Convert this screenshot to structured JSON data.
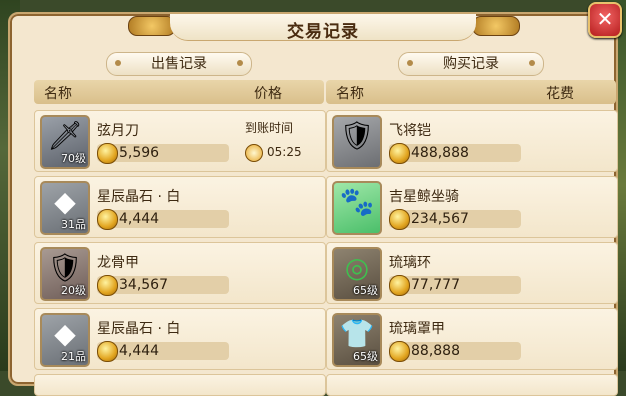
{
  "title": "交易记录",
  "close_label": "✕",
  "sell": {
    "tab_label": "出售记录",
    "col_name": "名称",
    "col_price": "价格",
    "arrival_label": "到账时间",
    "rows": [
      {
        "name": "弦月刀",
        "price": "5,596",
        "level": "70级",
        "icon": "blade-icon",
        "time": "05:25"
      },
      {
        "name": "星辰晶石 · 白",
        "price": "4,444",
        "level": "31品",
        "icon": "crystal-icon"
      },
      {
        "name": "龙骨甲",
        "price": "34,567",
        "level": "20级",
        "icon": "armor-icon"
      },
      {
        "name": "星辰晶石 · 白",
        "price": "4,444",
        "level": "21品",
        "icon": "crystal-icon"
      }
    ]
  },
  "buy": {
    "tab_label": "购买记录",
    "col_name": "名称",
    "col_price": "花费",
    "rows": [
      {
        "name": "飞将铠",
        "price": "488,888",
        "level": "",
        "icon": "armor-icon"
      },
      {
        "name": "吉星鲸坐骑",
        "price": "234,567",
        "level": "",
        "icon": "mount-icon"
      },
      {
        "name": "琉璃环",
        "price": "77,777",
        "level": "65级",
        "icon": "ring-icon"
      },
      {
        "name": "琉璃罩甲",
        "price": "88,888",
        "level": "65级",
        "icon": "vest-icon"
      }
    ]
  }
}
